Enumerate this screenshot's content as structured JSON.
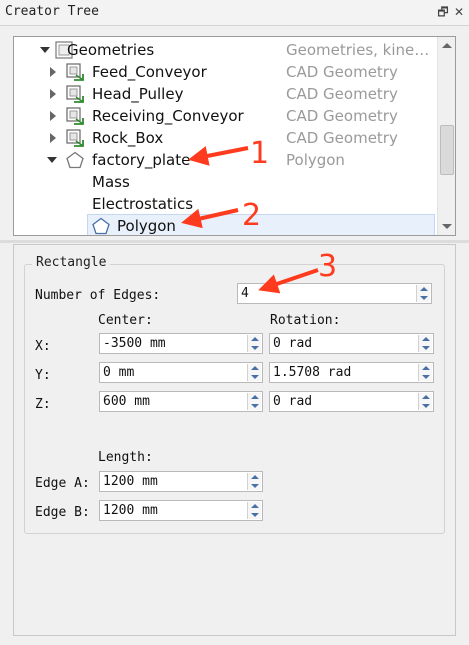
{
  "panel": {
    "title": "Creator Tree",
    "float_glyph": "🗗",
    "close_glyph": "✕"
  },
  "tree": {
    "items": [
      {
        "label": "Geometries",
        "desc": "Geometries, kine…",
        "icon": "geometry-group-icon"
      },
      {
        "label": "Feed_Conveyor",
        "desc": "CAD Geometry",
        "icon": "cad-geometry-icon"
      },
      {
        "label": "Head_Pulley",
        "desc": "CAD Geometry",
        "icon": "cad-geometry-icon"
      },
      {
        "label": "Receiving_Conveyor",
        "desc": "CAD Geometry",
        "icon": "cad-geometry-icon"
      },
      {
        "label": "Rock_Box",
        "desc": "CAD Geometry",
        "icon": "cad-geometry-icon"
      },
      {
        "label": "factory_plate",
        "desc": "Polygon",
        "icon": "polygon-icon"
      },
      {
        "label": "Mass"
      },
      {
        "label": "Electrostatics"
      },
      {
        "label": "Polygon",
        "icon": "polygon-icon"
      }
    ]
  },
  "properties": {
    "group_title": "Rectangle",
    "number_of_edges_label": "Number of Edges:",
    "number_of_edges_value": "4",
    "center_label": "Center:",
    "rotation_label": "Rotation:",
    "x_label": "X:",
    "y_label": "Y:",
    "z_label": "Z:",
    "center_x": "-3500 mm",
    "center_y": "0 mm",
    "center_z": "600 mm",
    "rotation_x": "0 rad",
    "rotation_y": "1.5708 rad",
    "rotation_z": "0 rad",
    "length_label": "Length:",
    "edge_a_label": "Edge A:",
    "edge_b_label": "Edge B:",
    "edge_a_value": "1200 mm",
    "edge_b_value": "1200 mm"
  },
  "annotations": {
    "marker_1": "1",
    "marker_2": "2",
    "marker_3": "3",
    "color": "#ff3b1f"
  }
}
